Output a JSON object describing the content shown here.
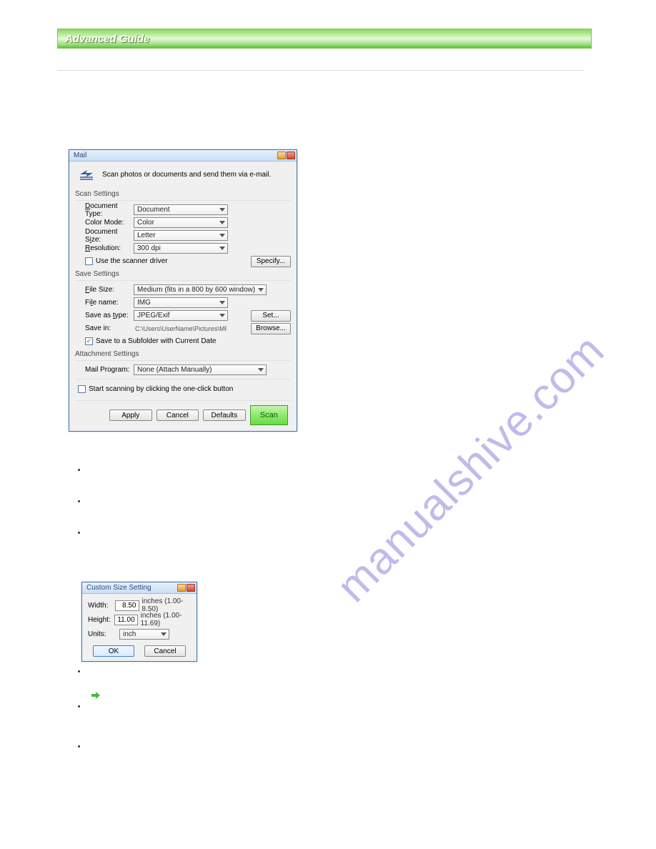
{
  "banner": {
    "title": "Advanced Guide"
  },
  "watermark": "manualshive.com",
  "mailDialog": {
    "title": "Mail",
    "intro": "Scan photos or documents and send them via e-mail.",
    "groups": {
      "scan": "Scan Settings",
      "save": "Save Settings",
      "attach": "Attachment Settings"
    },
    "scan": {
      "docTypeLabel": "Document Type:",
      "docTypeLabelU": "D",
      "docType": "Document",
      "colorModeLabel": "Color Mode:",
      "colorMode": "Color",
      "docSizeLabel": "Document Size:",
      "docSizeLabelU": "i",
      "docSize": "Letter",
      "resolutionLabel": "Resolution:",
      "resolutionLabelU": "R",
      "resolution": "300 dpi",
      "useDriver": "Use the scanner driver",
      "specifyBtn": "Specify..."
    },
    "save": {
      "fileSizeLabel": "File Size:",
      "fileSizeLabelU": "F",
      "fileSize": "Medium (fits in a 800 by 600 window)",
      "fileNameLabel": "File name:",
      "fileNameLabelU": "l",
      "fileName": "IMG",
      "saveTypeLabel": "Save as type:",
      "saveTypeLabelU": "t",
      "saveType": "JPEG/Exif",
      "setBtn": "Set...",
      "saveInLabel": "Save in:",
      "saveIn": "C:\\Users\\UserName\\Pictures\\MP Navigat",
      "browseBtn": "Browse...",
      "subfolder": "Save to a Subfolder with Current Date",
      "subfolderU": "C"
    },
    "attach": {
      "mailProgramLabel": "Mail Program:",
      "mailProgram": "None (Attach Manually)"
    },
    "oneClick": "Start scanning by clicking the one-click button",
    "buttons": {
      "apply": "Apply",
      "cancel": "Cancel",
      "defaults": "Defaults",
      "scan": "Scan"
    }
  },
  "customSize": {
    "title": "Custom Size Setting",
    "widthLabel": "Width:",
    "widthLabelU": "W",
    "width": "8.50",
    "widthRange": "inches (1.00-8.50)",
    "heightLabel": "Height:",
    "heightLabelU": "H",
    "height": "11.00",
    "heightRange": "inches (1.00-11.69)",
    "unitsLabel": "Units:",
    "unitsLabelU": "U",
    "units": "inch",
    "ok": "OK",
    "cancel": "Cancel"
  }
}
